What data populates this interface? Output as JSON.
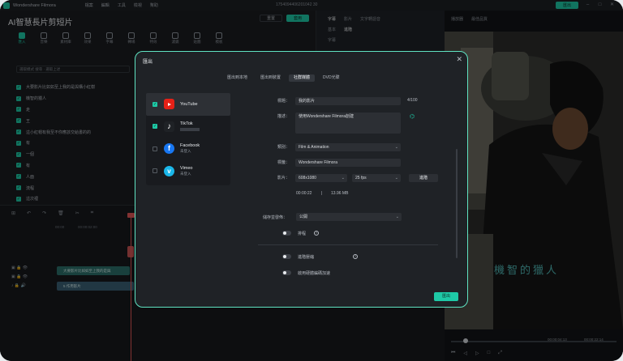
{
  "titlebar": {
    "app_name": "Wondershare Filmora",
    "menus": [
      "檔案",
      "編輯",
      "工具",
      "檢視",
      "幫助"
    ],
    "doc_title": "1754094406201042 30",
    "export_label": "匯出"
  },
  "left_panel": {
    "title": "AI智慧長片剪短片",
    "btn_reset": "重置",
    "btn_apply": "套用",
    "tools": [
      "匯入",
      "音樂",
      "素材庫",
      "效果",
      "字幕",
      "轉場",
      "特效",
      "濾鏡",
      "貼圖",
      "模板"
    ],
    "filter": "選取模式                    搜尋 · 選取上述",
    "captions": [
      "大要影片比如如至上我的是與構小紅樹",
      "機智的獵人",
      "走",
      "王",
      "這小紅帽有我至不你應該交給書的的",
      "有",
      "一個",
      "有",
      "人面",
      "流程",
      "這次裡"
    ]
  },
  "right_panel": {
    "tabs": [
      "字幕",
      "影片",
      "文字轉語音"
    ],
    "sub_tabs": [
      "基本",
      "進階"
    ],
    "label": "字幕"
  },
  "preview": {
    "tabs": [
      "播放器",
      "最佳品質"
    ],
    "caption": "機智的獵人",
    "time_current": "00:00:04:13",
    "time_total": "00:00:22:14",
    "controls": [
      "⏮",
      "◁",
      "▷",
      "□",
      "⤢"
    ]
  },
  "timeline": {
    "ruler": [
      "00:00",
      "00:00:02:00",
      "00:00:04:00",
      "00:00:06:00",
      "00:00:08:00",
      "00:00:10:00"
    ],
    "clip_caption": "大要影片比如如至上我的是與",
    "clip_video": "5 作用影片"
  },
  "modal": {
    "title": "匯出",
    "close": "✕",
    "tabs": [
      "匯出到本地",
      "匯出到裝置",
      "社群媒體",
      "DVD光碟"
    ],
    "active_tab": 2,
    "platforms": [
      {
        "name": "YouTube",
        "sub": "",
        "checked": true,
        "color": "#e62117"
      },
      {
        "name": "TikTok",
        "sub": "",
        "checked": true,
        "color": "#111111"
      },
      {
        "name": "Facebook",
        "sub": "未登入",
        "checked": false,
        "color": "#1877f2"
      },
      {
        "name": "Vimeo",
        "sub": "未登入",
        "checked": false,
        "color": "#1ab7ea"
      }
    ],
    "form": {
      "title_label": "標題：",
      "title_value": "我的影片",
      "title_count": "4/100",
      "desc_label": "描述：",
      "desc_value": "使用Wondershare Filmora創建",
      "category_label": "類別：",
      "category_value": "Film & Animation",
      "tags_label": "標籤：",
      "tags_value": "Wondershare Filmora",
      "video_label": "影片：",
      "resolution": "608x1080",
      "fps": "25 fps",
      "advanced": "進階",
      "duration": "00:00:22",
      "separator": "|",
      "size": "13.96 MB",
      "privacy_label": "儲存並發佈：",
      "privacy_value": "公開",
      "schedule_label": "排程",
      "advanced_render": "進階壓縮",
      "hw_accel": "啟用硬體編碼加速"
    },
    "export_button": "匯出"
  }
}
